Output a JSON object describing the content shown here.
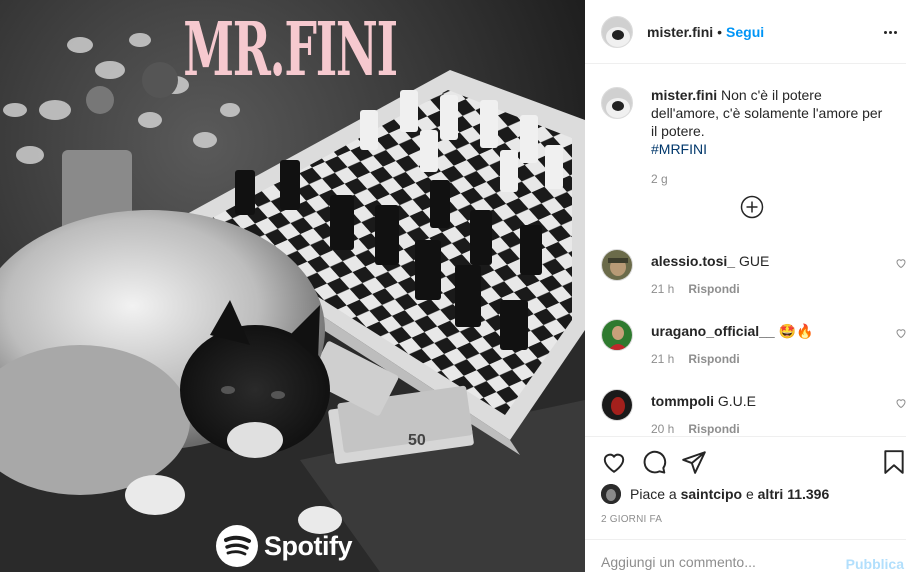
{
  "post": {
    "album_title": "MR.FINI",
    "banknote_value": "50",
    "spotify_label": "Spotify"
  },
  "header": {
    "username": "mister.fini",
    "separator": "•",
    "follow_label": "Segui",
    "more_icon": "more-options-icon"
  },
  "caption": {
    "username": "mister.fini",
    "text": "Non c'è il potere dell'amore, c'è solamente l'amore per il potere.",
    "hashtag": "#MRFINI",
    "time": "2 g"
  },
  "load_more_icon": "plus-circle-icon",
  "comments": [
    {
      "username": "alessio.tosi_",
      "text": "GUE",
      "time": "21 h",
      "reply_label": "Rispondi"
    },
    {
      "username": "uragano_official__",
      "text": "🤩🔥",
      "time": "21 h",
      "reply_label": "Rispondi"
    },
    {
      "username": "tommpoli",
      "text": "G.U.E",
      "time": "20 h",
      "reply_label": "Rispondi"
    }
  ],
  "actions": {
    "like_icon": "heart-icon",
    "comment_icon": "comment-icon",
    "share_icon": "share-icon",
    "save_icon": "bookmark-icon"
  },
  "likes": {
    "prefix": "Piace a ",
    "user": "saintcipo",
    "middle": " e ",
    "others": "altri 11.396"
  },
  "date": "2 GIORNI FA",
  "add_comment": {
    "placeholder": "Aggiungi un commento...",
    "publish_label": "Pubblica"
  },
  "colors": {
    "accent": "#0095f6",
    "title_pink": "#f6c9cf",
    "hashtag": "#00376b",
    "muted": "#8e8e8e",
    "publish_disabled": "#b2dffc"
  }
}
